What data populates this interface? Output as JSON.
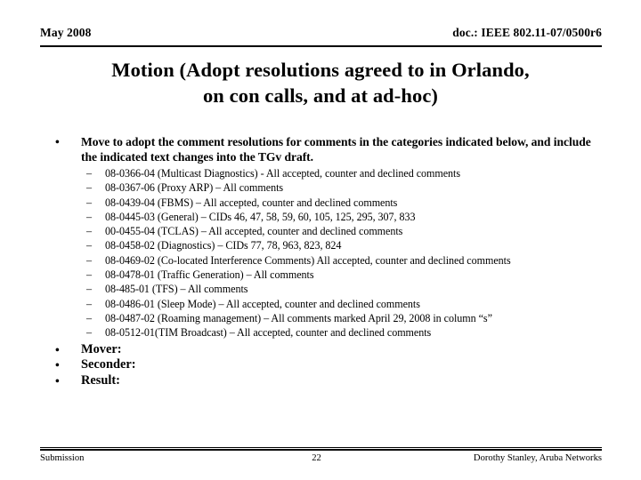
{
  "header": {
    "left": "May 2008",
    "right": "doc.: IEEE 802.11-07/0500r6"
  },
  "title": {
    "line1": "Motion  (Adopt resolutions agreed to in Orlando,",
    "line2": "on con calls, and at ad-hoc)"
  },
  "markers": {
    "level1": "•",
    "level2": "–"
  },
  "body": {
    "intro": "Move to adopt the comment resolutions for comments in the categories indicated below, and include the indicated text changes into the TGv draft.",
    "items": [
      "08-0366-04 (Multicast Diagnostics) - All accepted, counter and declined comments",
      "08-0367-06 (Proxy ARP) – All comments",
      "08-0439-04 (FBMS) – All accepted, counter and declined comments",
      "08-0445-03 (General) – CIDs 46, 47, 58, 59, 60, 105, 125, 295, 307, 833",
      "00-0455-04 (TCLAS) – All accepted, counter and declined comments",
      "08-0458-02 (Diagnostics) – CIDs 77, 78, 963, 823, 824",
      "08-0469-02 (Co-located Interference Comments) All accepted, counter and declined comments",
      "08-0478-01 (Traffic Generation) – All comments",
      "08-485-01 (TFS) – All comments",
      "08-0486-01 (Sleep Mode) – All accepted, counter and declined comments",
      "08-0487-02 (Roaming management) – All comments marked April 29, 2008 in column “s”",
      "08-0512-01(TIM Broadcast) – All accepted, counter and declined comments"
    ],
    "closing": [
      "Mover:",
      "Seconder:",
      "Result:"
    ]
  },
  "footer": {
    "left": "Submission",
    "page": "22",
    "right": "Dorothy Stanley, Aruba Networks"
  }
}
